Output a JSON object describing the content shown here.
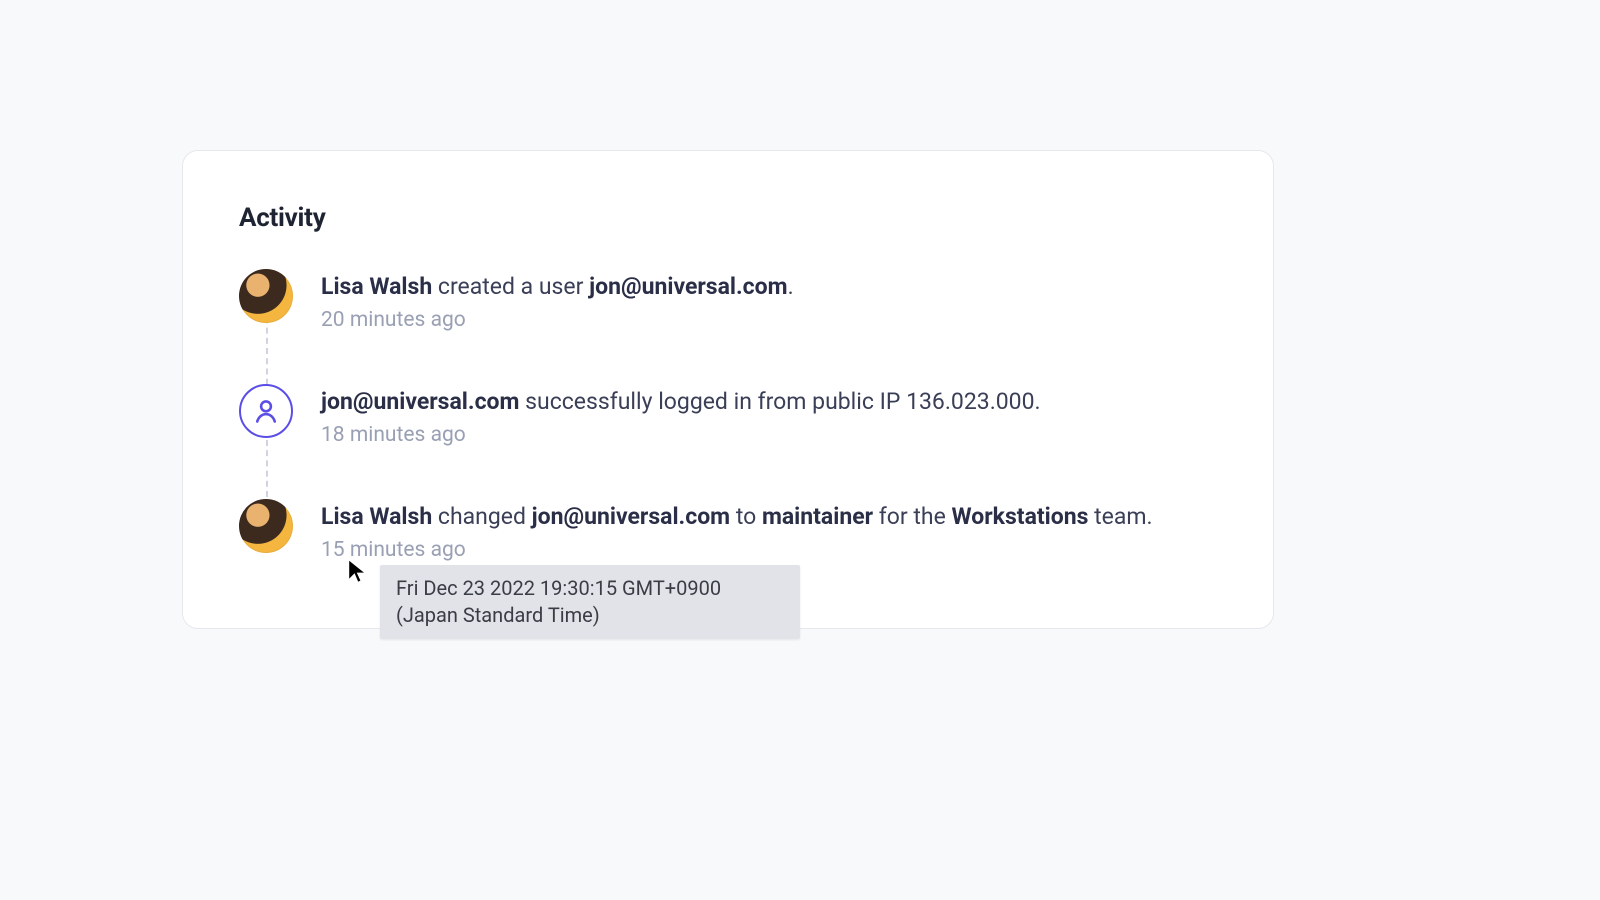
{
  "panel": {
    "title": "Activity"
  },
  "items": [
    {
      "actor": "Lisa Walsh",
      "mid1": " created a user ",
      "obj1": "jon@universal.com",
      "tail": ".",
      "time": "20 minutes ago"
    },
    {
      "actor": "jon@universal.com",
      "mid1": " successfully logged in from public IP 136.023.000.",
      "time": "18 minutes ago"
    },
    {
      "actor": "Lisa Walsh",
      "mid1": " changed ",
      "obj1": "jon@universal.com",
      "mid2": " to ",
      "obj2": "maintainer",
      "mid3": " for the ",
      "obj3": "Workstations",
      "tail": " team.",
      "time": "15 minutes ago"
    }
  ],
  "tooltip": {
    "text": "Fri Dec 23 2022 19:30:15 GMT+0900 (Japan Standard Time)"
  }
}
